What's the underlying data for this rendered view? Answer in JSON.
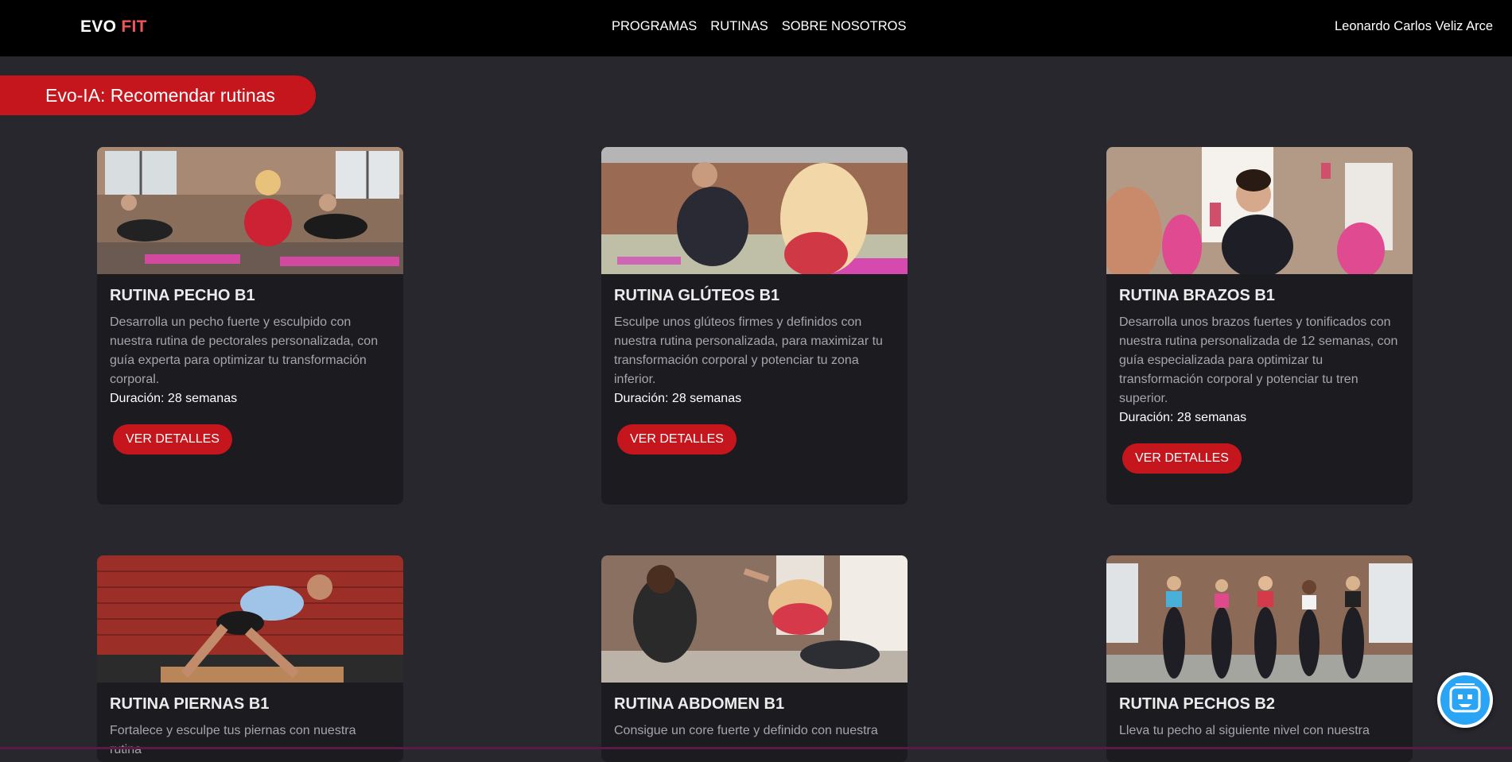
{
  "navbar": {
    "brand_part1": "EVO",
    "brand_part2": "FIT",
    "links": [
      "PROGRAMAS",
      "RUTINAS",
      "SOBRE NOSOTROS"
    ],
    "user_name": "Leonardo Carlos Veliz Arce"
  },
  "ai_banner": {
    "label": "Evo-IA: Recomendar rutinas"
  },
  "cards": [
    {
      "title": "RUTINA PECHO B1",
      "description": "Desarrolla un pecho fuerte y esculpido con nuestra rutina de pectorales personalizada, con guía experta para optimizar tu transformación corporal.",
      "duration": "Duración: 28 semanas",
      "button": "VER DETALLES"
    },
    {
      "title": "RUTINA GLÚTEOS B1",
      "description": "Esculpe unos glúteos firmes y definidos con nuestra rutina personalizada, para maximizar tu transformación corporal y potenciar tu zona inferior.",
      "duration": "Duración: 28 semanas",
      "button": "VER DETALLES"
    },
    {
      "title": "RUTINA BRAZOS B1",
      "description": "Desarrolla unos brazos fuertes y tonificados con nuestra rutina personalizada de 12 semanas, con guía especializada para optimizar tu transformación corporal y potenciar tu tren superior.",
      "duration": "Duración: 28 semanas",
      "button": "VER DETALLES"
    },
    {
      "title": "RUTINA PIERNAS B1",
      "description": "Fortalece y esculpe tus piernas con nuestra rutina"
    },
    {
      "title": "RUTINA ABDOMEN B1",
      "description": "Consigue un core fuerte y definido con nuestra"
    },
    {
      "title": "RUTINA PECHOS B2",
      "description": "Lleva tu pecho al siguiente nivel con nuestra"
    }
  ],
  "colors": {
    "background": "#27272d",
    "navbar": "#000000",
    "accent_red": "#c4161c",
    "brand_accent": "#ef5757",
    "card_bg": "#1b1b20",
    "chat_button": "#2aa4f4"
  },
  "icons": {
    "chat_button": "robot-chat-icon"
  }
}
